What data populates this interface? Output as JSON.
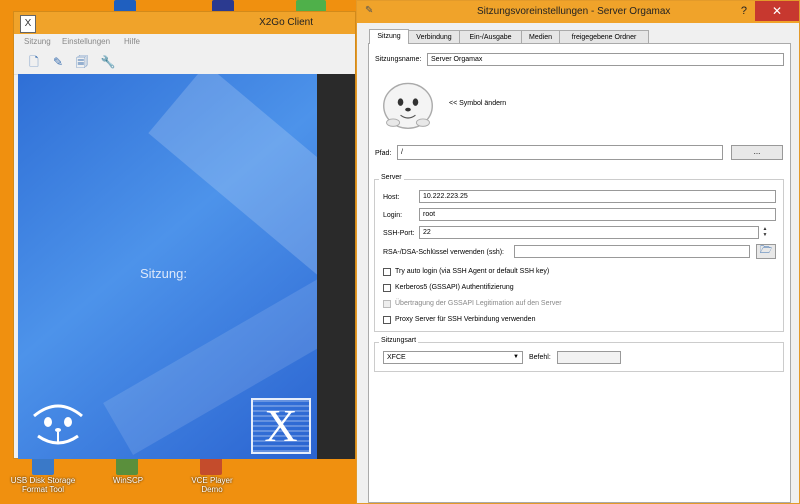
{
  "desktop": {
    "icons": [
      {
        "label": "USB Disk Storage Format Tool"
      },
      {
        "label": "WinSCP"
      },
      {
        "label": "VCE Player Demo"
      }
    ]
  },
  "x2go": {
    "title": "X2Go Client",
    "menu": [
      "Sitzung",
      "Einstellungen",
      "Hilfe"
    ],
    "toolbar": [
      "new-session-icon",
      "edit-session-icon",
      "session-settings-icon",
      "options-icon"
    ],
    "session_label": "Sitzung:",
    "logo_text": "X"
  },
  "dialog": {
    "title": "Sitzungsvoreinstellungen - Server Orgamax",
    "help": "?",
    "close": "✕",
    "tabs": [
      "Sitzung",
      "Verbindung",
      "Ein-/Ausgabe",
      "Medien",
      "freigegebene Ordner"
    ],
    "session_name_label": "Sitzungsname:",
    "session_name_value": "Server Orgamax",
    "change_icon_label": "<< Symbol ändern",
    "path_label": "Pfad:",
    "path_value": "/",
    "browse_button": "...",
    "server": {
      "group_title": "Server",
      "host_label": "Host:",
      "host_value": "10.222.223.25",
      "login_label": "Login:",
      "login_value": "root",
      "ssh_port_label": "SSH-Port:",
      "ssh_port_value": "22",
      "rsa_label": "RSA-/DSA-Schlüssel verwenden (ssh):",
      "rsa_value": "",
      "checkboxes": [
        {
          "label": "Try auto login (via SSH Agent or default SSH key)",
          "checked": false,
          "enabled": true
        },
        {
          "label": "Kerberos5 (GSSAPI) Authentifizierung",
          "checked": false,
          "enabled": true
        },
        {
          "label": "Übertragung der GSSAPI Legitimation auf den Server",
          "checked": false,
          "enabled": false
        },
        {
          "label": "Proxy Server für SSH Verbindung verwenden",
          "checked": false,
          "enabled": true
        }
      ]
    },
    "session_type": {
      "group_title": "Sitzungsart",
      "selected": "XFCE",
      "command_label": "Befehl:",
      "command_value": ""
    }
  }
}
